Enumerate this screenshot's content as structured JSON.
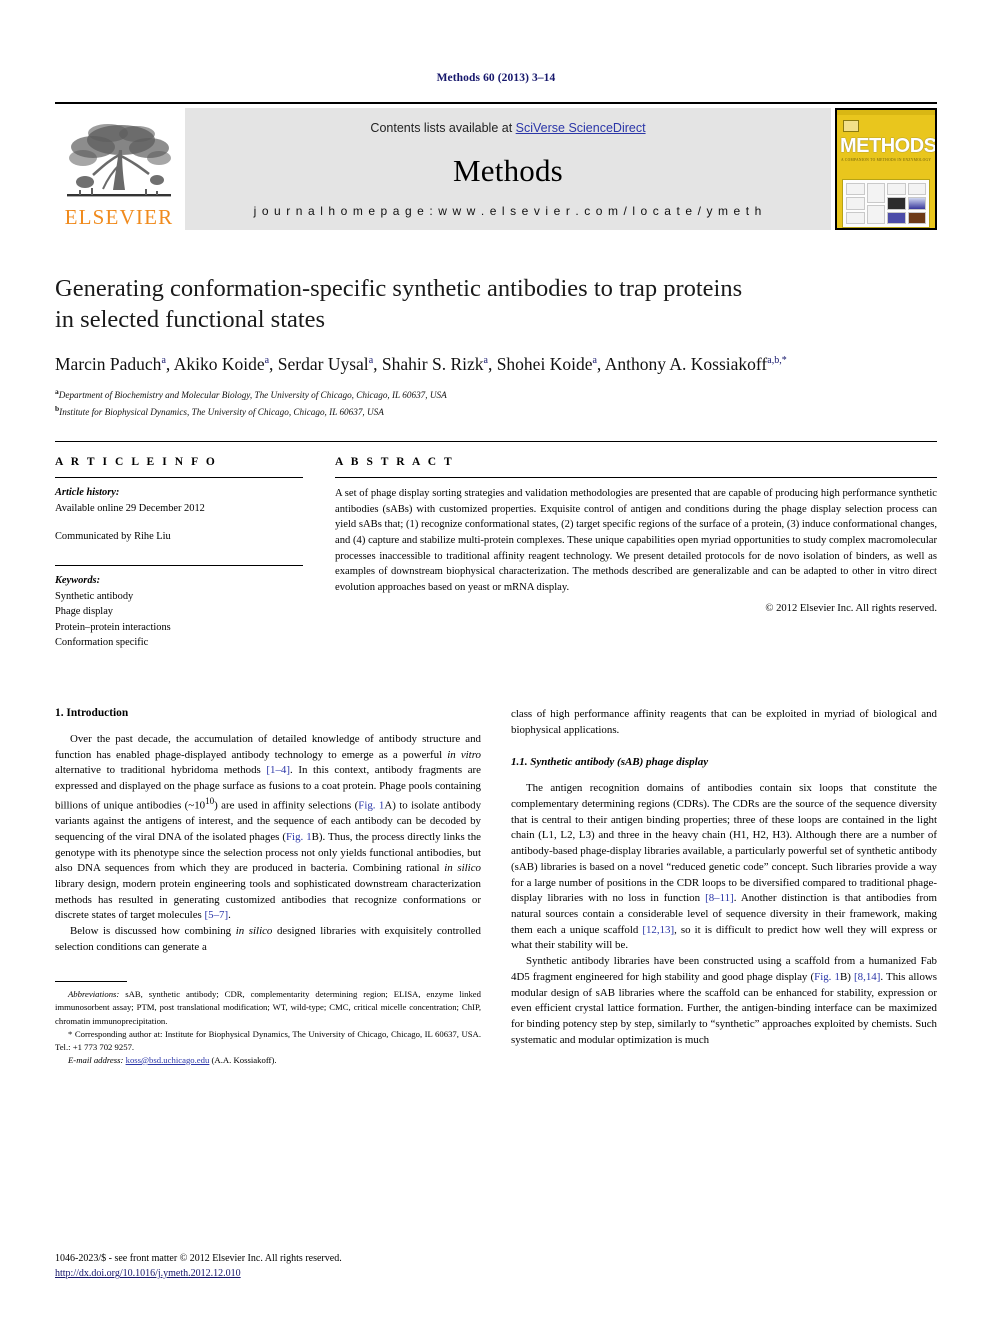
{
  "running_head": "Methods 60 (2013) 3–14",
  "banner": {
    "publisher": "ELSEVIER",
    "contents_prefix": "Contents lists available at ",
    "contents_link": "SciVerse ScienceDirect",
    "journal_title": "Methods",
    "homepage": "j o u r n a l   h o m e p a g e :   w w w . e l s e v i e r . c o m / l o c a t e / y m e t h",
    "cover_title": "METHODS",
    "cover_subtitle": "A COMPANION TO METHODS IN ENZYMOLOGY",
    "colors": {
      "elsevier_orange": "#f08a1c",
      "link_blue": "#2b36a8",
      "banner_gray": "#e4e4e4",
      "cover_yellow": "#e9c61d"
    }
  },
  "article": {
    "title_line1": "Generating conformation-specific synthetic antibodies to trap proteins",
    "title_line2": "in selected functional states",
    "authors": [
      {
        "name": "Marcin Paduch",
        "sup": "a"
      },
      {
        "name": "Akiko Koide",
        "sup": "a"
      },
      {
        "name": "Serdar Uysal",
        "sup": "a"
      },
      {
        "name": "Shahir S. Rizk",
        "sup": "a"
      },
      {
        "name": "Shohei Koide",
        "sup": "a"
      },
      {
        "name": "Anthony A. Kossiakoff",
        "sup": "a,b,*"
      }
    ],
    "affiliations": [
      {
        "mark": "a",
        "text": "Department of Biochemistry and Molecular Biology, The University of Chicago, Chicago, IL 60637, USA"
      },
      {
        "mark": "b",
        "text": "Institute for Biophysical Dynamics, The University of Chicago, Chicago, IL 60637, USA"
      }
    ]
  },
  "article_info": {
    "heading": "A R T I C L E   I N F O",
    "history_label": "Article history:",
    "history_value": "Available online 29 December 2012",
    "communicated": "Communicated by Rihe Liu",
    "keywords_label": "Keywords:",
    "keywords": [
      "Synthetic antibody",
      "Phage display",
      "Protein–protein interactions",
      "Conformation specific"
    ]
  },
  "abstract": {
    "heading": "A B S T R A C T",
    "text": "A set of phage display sorting strategies and validation methodologies are presented that are capable of producing high performance synthetic antibodies (sABs) with customized properties. Exquisite control of antigen and conditions during the phage display selection process can yield sABs that; (1) recognize conformational states, (2) target specific regions of the surface of a protein, (3) induce conformational changes, and (4) capture and stabilize multi-protein complexes. These unique capabilities open myriad opportunities to study complex macromolecular processes inaccessible to traditional affinity reagent technology. We present detailed protocols for de novo isolation of binders, as well as examples of downstream biophysical characterization. The methods described are generalizable and can be adapted to other in vitro direct evolution approaches based on yeast or mRNA display.",
    "copyright": "© 2012 Elsevier Inc. All rights reserved."
  },
  "body": {
    "section1_heading": "1. Introduction",
    "p1_a": "Over the past decade, the accumulation of detailed knowledge of antibody structure and function has enabled phage-displayed antibody technology to emerge as a powerful ",
    "p1_italic1": "in vitro",
    "p1_b": " alternative to traditional hybridoma methods ",
    "p1_ref1": "[1–4]",
    "p1_c": ". In this context, antibody fragments are expressed and displayed on the phage surface as fusions to a coat protein. Phage pools containing billions of unique antibodies (~10",
    "p1_sup": "10",
    "p1_d": ") are used in affinity selections (",
    "p1_ref2": "Fig. 1",
    "p1_e": "A) to isolate antibody variants against the antigens of interest, and the sequence of each antibody can be decoded by sequencing of the viral DNA of the isolated phages (",
    "p1_ref3": "Fig. 1",
    "p1_f": "B). Thus, the process directly links the genotype with its phenotype since the selection process not only yields functional antibodies, but also DNA sequences from which they are produced in bacteria. Combining rational ",
    "p1_italic2": "in silico",
    "p1_g": " library design, modern protein engineering tools and sophisticated downstream characterization methods has resulted in generating customized antibodies that recognize conformations or discrete states of target molecules ",
    "p1_ref4": "[5–7]",
    "p1_h": ".",
    "p2_a": "Below is discussed how combining ",
    "p2_italic": "in silico",
    "p2_b": " designed libraries with exquisitely controlled selection conditions can generate a",
    "p3": "class of high performance affinity reagents that can be exploited in myriad of biological and biophysical applications.",
    "subsection11_heading": "1.1. Synthetic antibody (sAB) phage display",
    "p4_a": "The antigen recognition domains of antibodies contain six loops that constitute the complementary determining regions (CDRs). The CDRs are the source of the sequence diversity that is central to their antigen binding properties; three of these loops are contained in the light chain (L1, L2, L3) and three in the heavy chain (H1, H2, H3). Although there are a number of antibody-based phage-display libraries available, a particularly powerful set of synthetic antibody (sAB) libraries is based on a novel “reduced genetic code” concept. Such libraries provide a way for a large number of positions in the CDR loops to be diversified compared to traditional phage-display libraries with no loss in function ",
    "p4_ref1": "[8–11]",
    "p4_b": ". Another distinction is that antibodies from natural sources contain a considerable level of sequence diversity in their framework, making them each a unique scaffold ",
    "p4_ref2": "[12,13]",
    "p4_c": ", so it is difficult to predict how well they will express or what their stability will be.",
    "p5_a": "Synthetic antibody libraries have been constructed using a scaffold from a humanized Fab 4D5 fragment engineered for high stability and good phage display (",
    "p5_ref1": "Fig. 1",
    "p5_b": "B) ",
    "p5_ref2": "[8,14]",
    "p5_c": ". This allows modular design of sAB libraries where the scaffold can be enhanced for stability, expression or even efficient crystal lattice formation. Further, the antigen-binding interface can be maximized for binding potency step by step, similarly to “synthetic” approaches exploited by chemists. Such systematic and modular optimization is much"
  },
  "footnotes": {
    "abbrev_label": "Abbreviations:",
    "abbrev_text": " sAB, synthetic antibody; CDR, complementarity determining region; ELISA, enzyme linked immunosorbent assay; PTM, post translational modification; WT, wild-type; CMC, critical micelle concentration; ChIP, chromatin immunoprecipitation.",
    "corresponding": "* Corresponding author at: Institute for Biophysical Dynamics, The University of Chicago, Chicago, IL 60637, USA. Tel.: +1 773 702 9257.",
    "email_label": "E-mail address:",
    "email_value": "koss@bsd.uchicago.edu",
    "email_attrib": " (A.A. Kossiakoff)."
  },
  "footer": {
    "issn_line": "1046-2023/$ - see front matter © 2012 Elsevier Inc. All rights reserved.",
    "doi": "http://dx.doi.org/10.1016/j.ymeth.2012.12.010"
  }
}
